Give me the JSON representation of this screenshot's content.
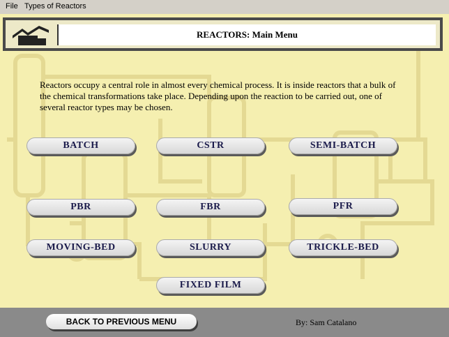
{
  "menubar": {
    "file": "File",
    "types": "Types of Reactors"
  },
  "header": {
    "title": "REACTORS: Main Menu"
  },
  "intro": "Reactors occupy a central role in almost every chemical process.  It is inside reactors that a bulk of the chemical transformations take place.  Depending upon the reaction to be carried out, one of several reactor types may be chosen.",
  "buttons": {
    "batch": "BATCH",
    "cstr": "CSTR",
    "semibatch": "SEMI-BATCH",
    "pbr": "PBR",
    "fbr": "FBR",
    "pfr": "PFR",
    "movingbed": "MOVING-BED",
    "slurry": "SLURRY",
    "tricklebed": "TRICKLE-BED",
    "fixedfilm": "FIXED FILM"
  },
  "footer": {
    "back": "BACK TO PREVIOUS MENU",
    "author": "By: Sam Catalano"
  },
  "colors": {
    "background": "#f5efb0",
    "button_text": "#1a1a4a",
    "frame": "#4a4a4a"
  }
}
